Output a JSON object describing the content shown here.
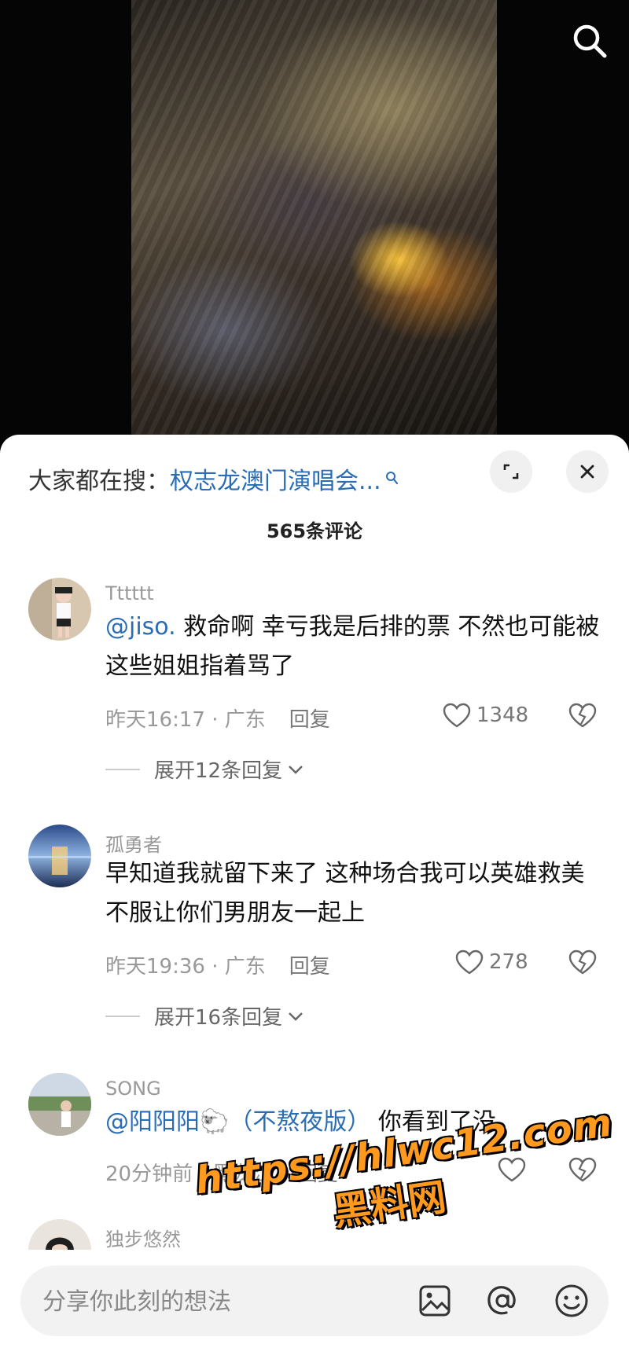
{
  "hot_search": {
    "label": "大家都在搜：",
    "keyword": "权志龙澳门演唱会..."
  },
  "comment_count": "565条评论",
  "reply_label": "回复",
  "comments": [
    {
      "user": "Tttttt",
      "mention": "@jiso.",
      "text": " 救命啊 幸亏我是后排的票 不然也可能被这些姐姐指着骂了",
      "time_loc": "昨天16:17 · 广东",
      "likes": "1348",
      "expand": "展开12条回复"
    },
    {
      "user": "孤勇者",
      "mention": "",
      "text": "早知道我就留下来了 这种场合我可以英雄救美 不服让你们男朋友一起上",
      "time_loc": "昨天19:36 · 广东",
      "likes": "278",
      "expand": "展开16条回复"
    },
    {
      "user": "SONG",
      "mention": "@阳阳阳🐑（不熬夜版）",
      "text": " 你看到了没",
      "time_loc": "20分钟前 · 黑龙江",
      "likes": ""
    },
    {
      "user": "独步悠然"
    }
  ],
  "input": {
    "placeholder": "分享你此刻的想法"
  },
  "watermark": {
    "url": "https://hlwc12.com",
    "text": "黑料网"
  },
  "colors": {
    "mention": "#2a6db5",
    "watermark": "#ff9a1f"
  }
}
